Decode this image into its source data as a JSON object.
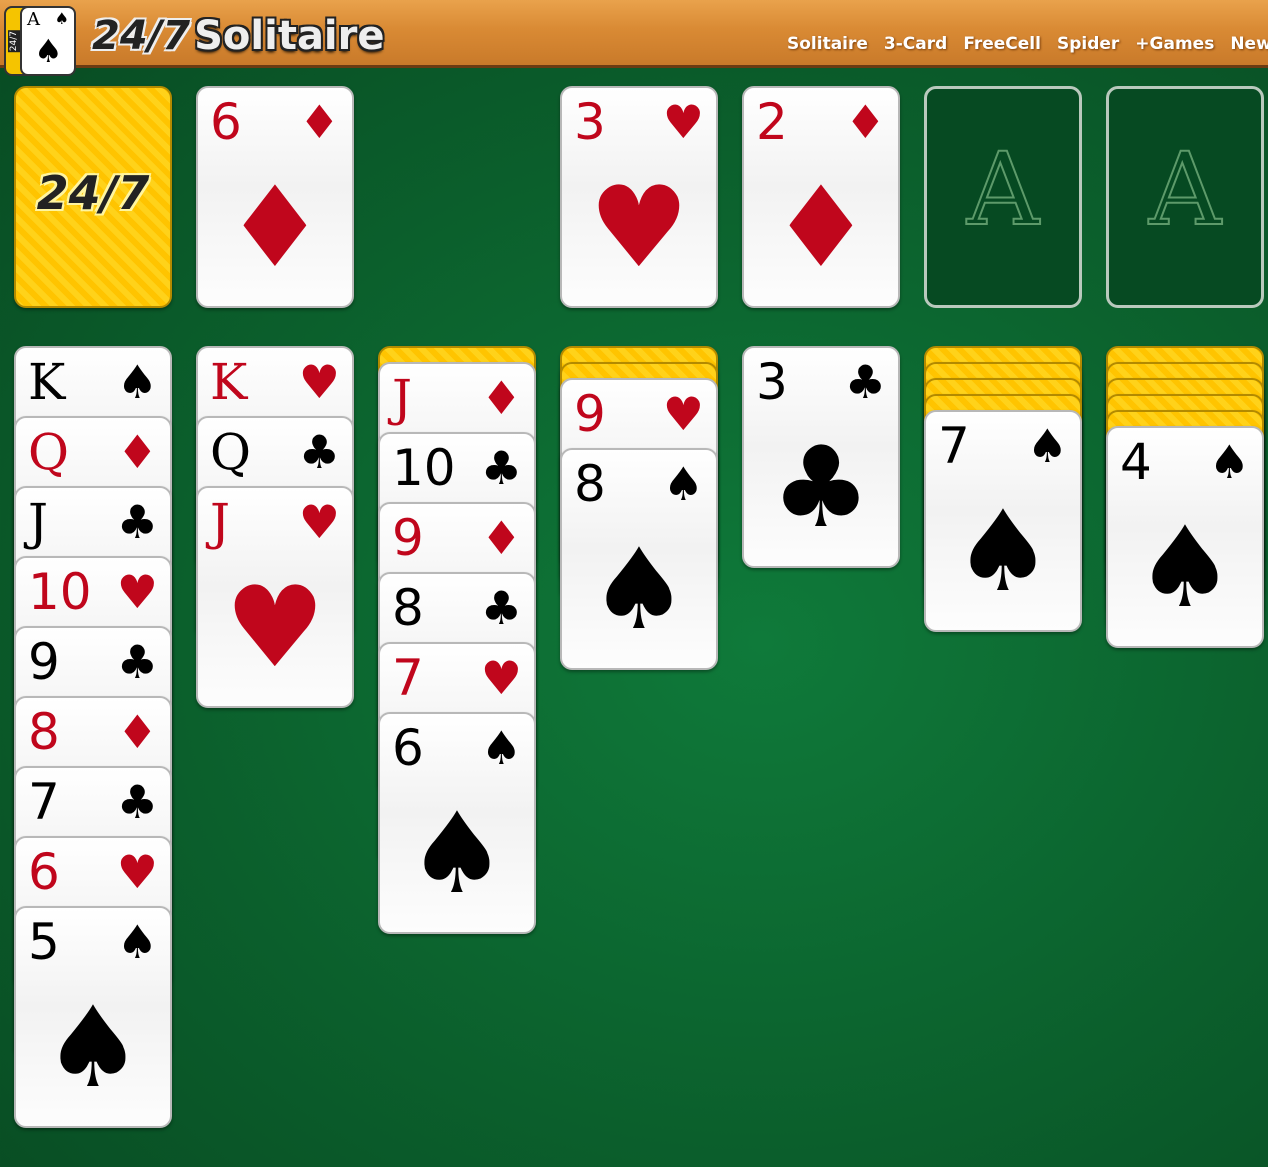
{
  "header": {
    "logo_card": {
      "rank": "A",
      "suit": "♠",
      "stack_label": "24/7"
    },
    "brand_number": "24/7",
    "brand_name": "Solitaire",
    "nav": [
      "Solitaire",
      "3-Card",
      "FreeCell",
      "Spider",
      "+Games",
      "News"
    ]
  },
  "colors": {
    "felt": "#0b5f2c",
    "red_suit": "#c0061c",
    "card_back": "#ffc400",
    "header_wood": "#d98a34"
  },
  "card_back_label": "24/7",
  "stock": {
    "face_down": true
  },
  "waste": {
    "rank": "6",
    "suit": "♦"
  },
  "foundations": [
    {
      "rank": "3",
      "suit": "♥"
    },
    {
      "rank": "2",
      "suit": "♦"
    },
    {
      "empty_label": "A"
    },
    {
      "empty_label": "A"
    }
  ],
  "tableau": [
    {
      "face_down": 0,
      "cards": [
        {
          "rank": "K",
          "suit": "♠"
        },
        {
          "rank": "Q",
          "suit": "♦"
        },
        {
          "rank": "J",
          "suit": "♣"
        },
        {
          "rank": "10",
          "suit": "♥"
        },
        {
          "rank": "9",
          "suit": "♣"
        },
        {
          "rank": "8",
          "suit": "♦"
        },
        {
          "rank": "7",
          "suit": "♣"
        },
        {
          "rank": "6",
          "suit": "♥"
        },
        {
          "rank": "5",
          "suit": "♠"
        }
      ]
    },
    {
      "face_down": 0,
      "cards": [
        {
          "rank": "K",
          "suit": "♥"
        },
        {
          "rank": "Q",
          "suit": "♣"
        },
        {
          "rank": "J",
          "suit": "♥"
        }
      ]
    },
    {
      "face_down": 1,
      "cards": [
        {
          "rank": "J",
          "suit": "♦"
        },
        {
          "rank": "10",
          "suit": "♣"
        },
        {
          "rank": "9",
          "suit": "♦"
        },
        {
          "rank": "8",
          "suit": "♣"
        },
        {
          "rank": "7",
          "suit": "♥"
        },
        {
          "rank": "6",
          "suit": "♠"
        }
      ]
    },
    {
      "face_down": 2,
      "cards": [
        {
          "rank": "9",
          "suit": "♥"
        },
        {
          "rank": "8",
          "suit": "♠"
        }
      ]
    },
    {
      "face_down": 0,
      "cards": [
        {
          "rank": "3",
          "suit": "♣"
        }
      ]
    },
    {
      "face_down": 4,
      "cards": [
        {
          "rank": "7",
          "suit": "♠"
        }
      ]
    },
    {
      "face_down": 5,
      "cards": [
        {
          "rank": "4",
          "suit": "♠"
        }
      ]
    }
  ]
}
